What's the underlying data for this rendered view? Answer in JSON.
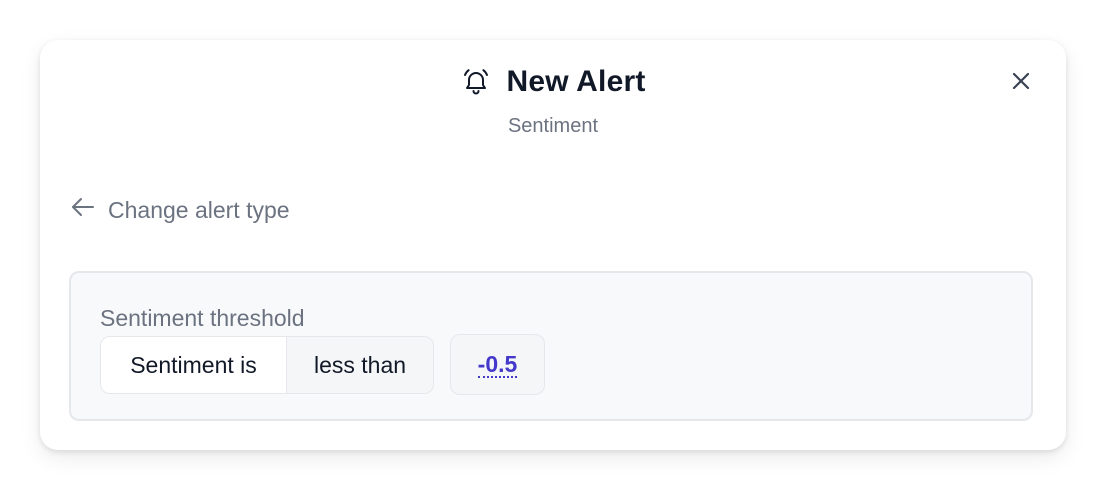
{
  "modal": {
    "title": "New Alert",
    "subtitle": "Sentiment",
    "icon": "bell-icon",
    "close_icon": "close-icon"
  },
  "back_link": {
    "label": "Change alert type",
    "icon": "arrow-left-icon"
  },
  "threshold": {
    "label": "Sentiment threshold",
    "subject": "Sentiment is",
    "operator": "less than",
    "value": "-0.5"
  },
  "colors": {
    "title": "#111827",
    "muted": "#6b7280",
    "accent": "#4338ca",
    "panel_bg": "#f8f9fb",
    "border": "#e5e7eb"
  }
}
